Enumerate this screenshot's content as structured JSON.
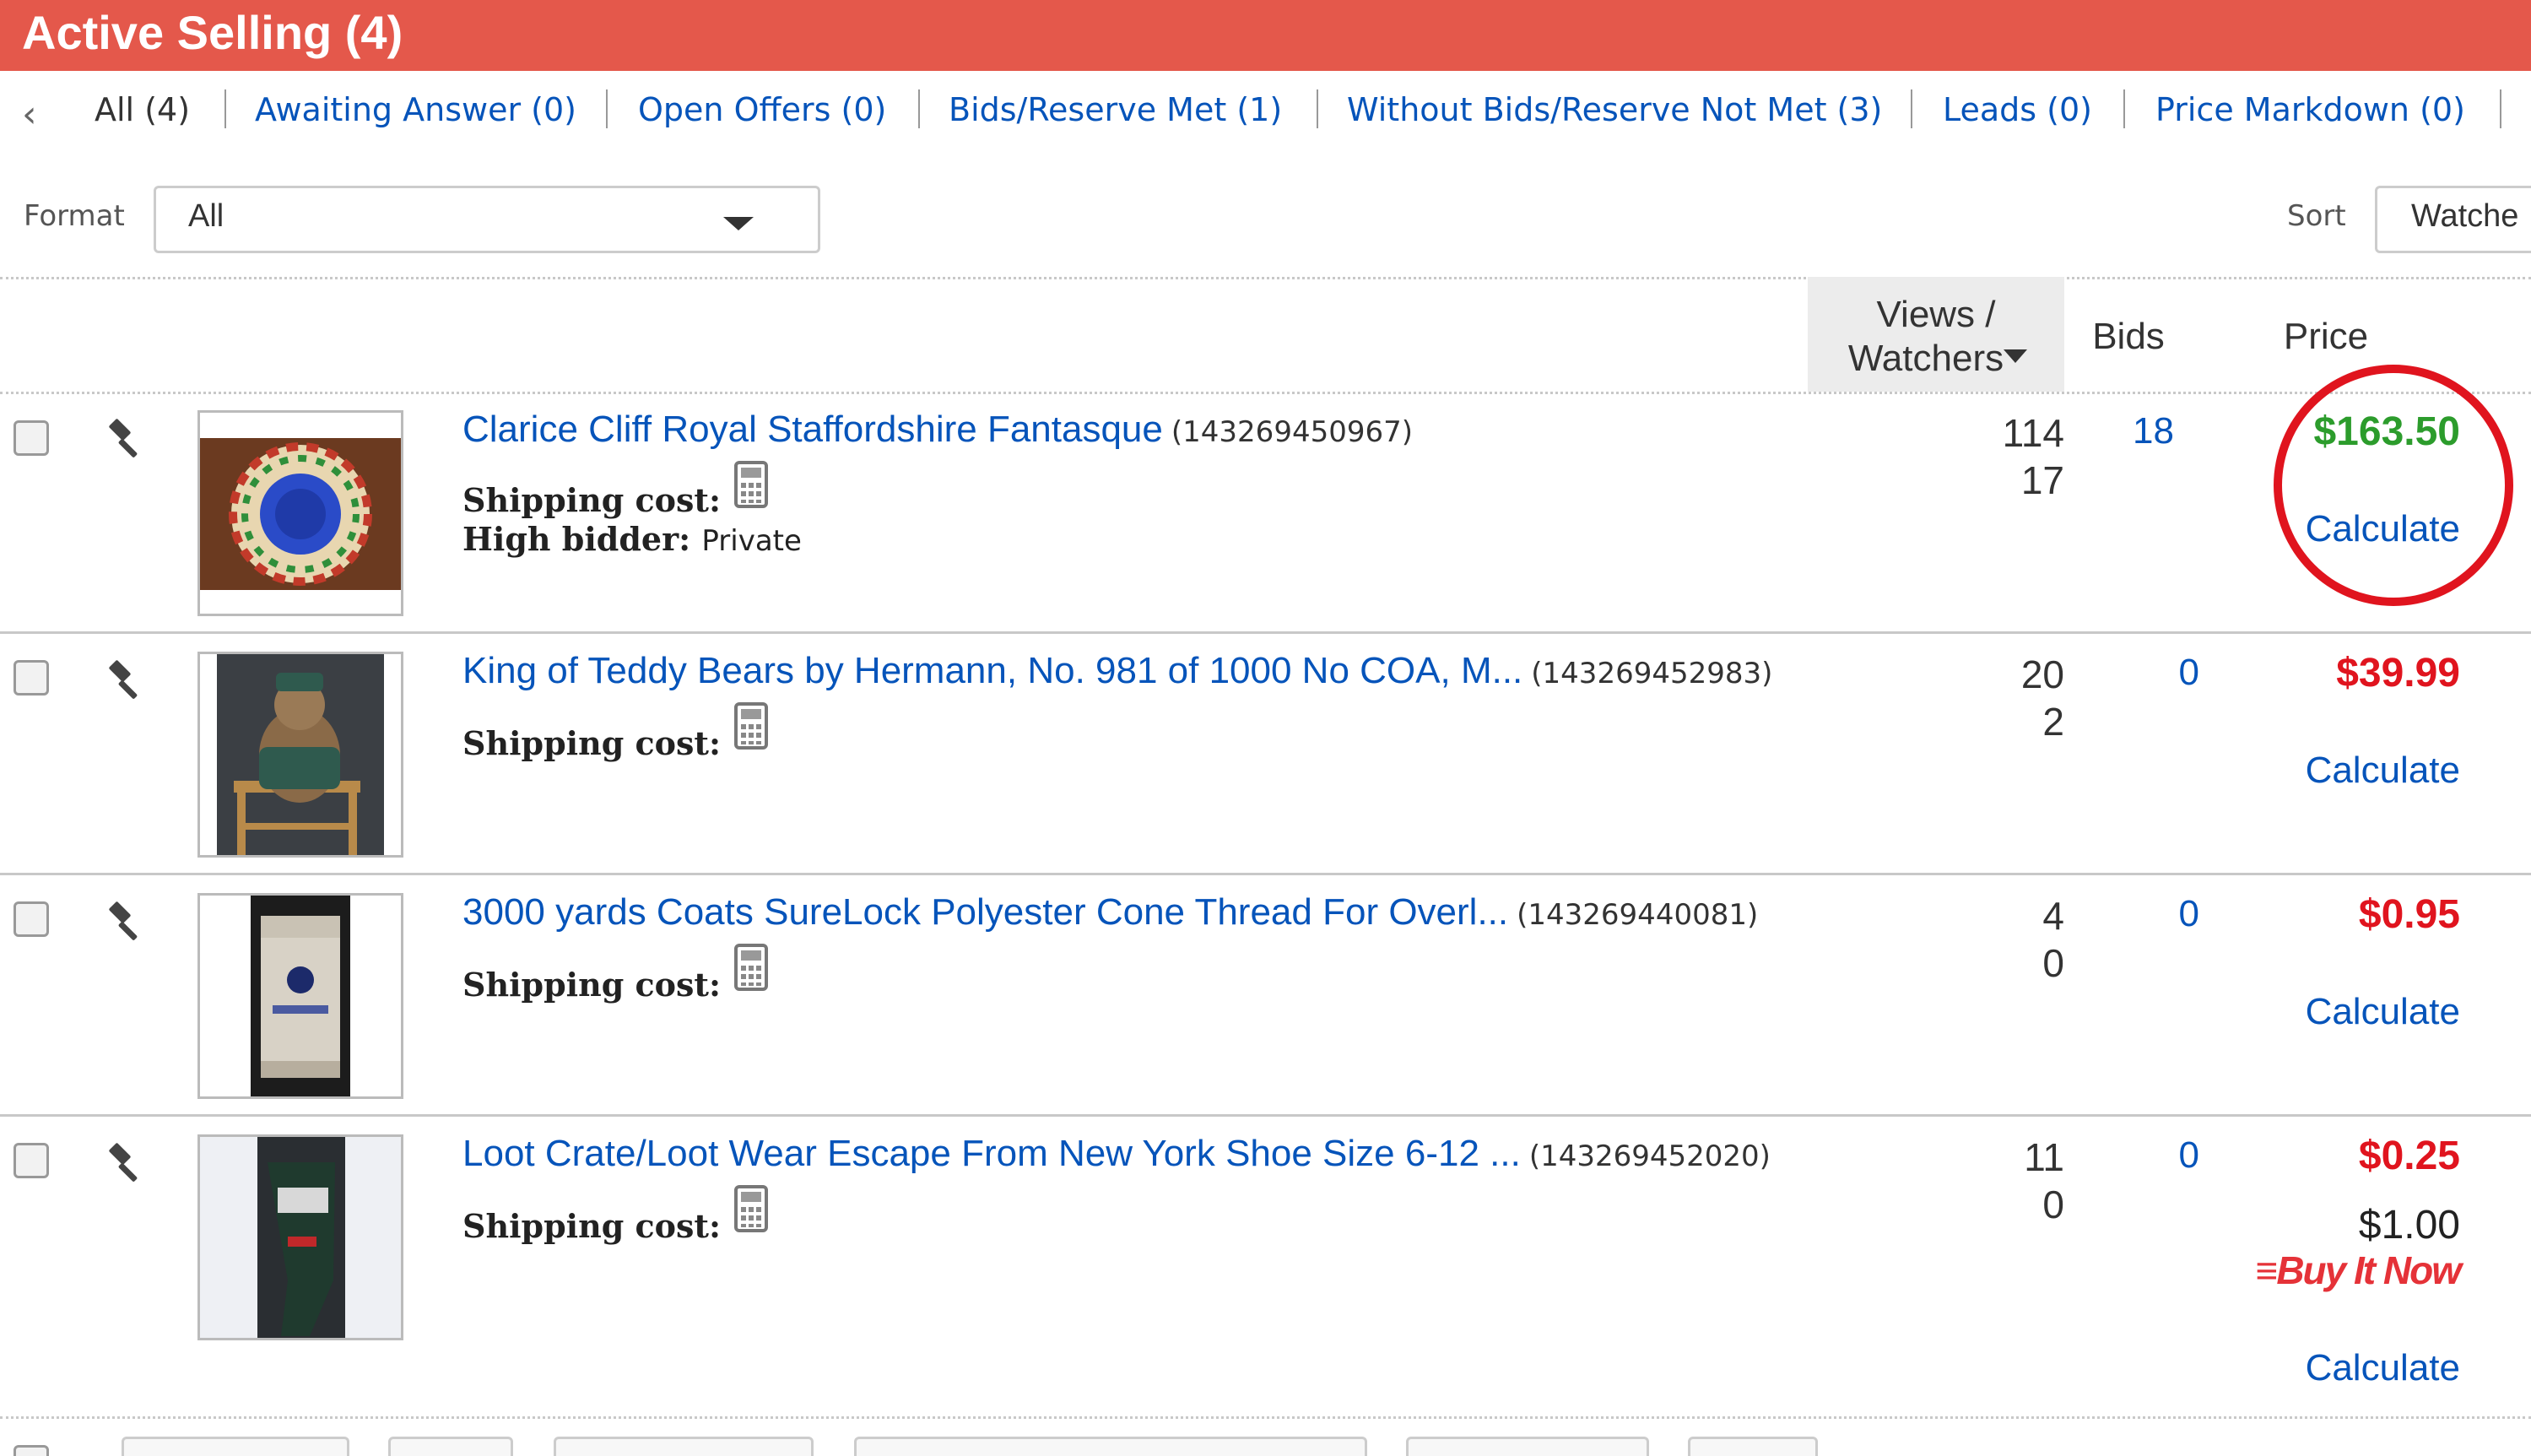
{
  "header": {
    "title": "Active Selling (4)"
  },
  "tabs": [
    {
      "label": "All (4)"
    },
    {
      "label": "Awaiting Answer (0)"
    },
    {
      "label": "Open Offers (0)"
    },
    {
      "label": "Bids/Reserve Met (1)"
    },
    {
      "label": "Without Bids/Reserve Not Met (3)"
    },
    {
      "label": "Leads (0)"
    },
    {
      "label": "Price Markdown (0)"
    }
  ],
  "filters": {
    "format_label": "Format",
    "format_value": "All",
    "sort_label": "Sort",
    "sort_value": "Watche"
  },
  "columns": {
    "views_line1": "Views /",
    "views_line2": "Watchers",
    "bids": "Bids",
    "price": "Price"
  },
  "labels": {
    "shipping": "Shipping cost:",
    "high_bidder": "High bidder:",
    "calculate": "Calculate"
  },
  "items": [
    {
      "title": "Clarice Cliff Royal Staffordshire Fantasque",
      "id": "(143269450967)",
      "views": "114",
      "watchers": "17",
      "bids": "18",
      "price": "$163.50",
      "price_color": "#2c9c2c",
      "high_bidder": "Private"
    },
    {
      "title": "King of Teddy Bears by Hermann, No. 981 of 1000 No COA, M...",
      "id": "(143269452983)",
      "views": "20",
      "watchers": "2",
      "bids": "0",
      "price": "$39.99",
      "price_color": "#e0141e"
    },
    {
      "title": "3000 yards Coats SureLock Polyester Cone Thread For Overl...",
      "id": "(143269440081)",
      "views": "4",
      "watchers": "0",
      "bids": "0",
      "price": "$0.95",
      "price_color": "#e0141e"
    },
    {
      "title": "Loot Crate/Loot Wear Escape From New York Shoe Size 6-12 ...",
      "id": "(143269452020)",
      "views": "11",
      "watchers": "0",
      "bids": "0",
      "price": "$0.25",
      "price_color": "#e0141e",
      "buy_it_now_price": "$1.00",
      "buy_it_now_label": "≡Buy It Now"
    }
  ],
  "icons": {
    "back": "chevron-left-icon",
    "dropdown": "chevron-down-icon",
    "auction": "gavel-icon",
    "shipping_calc": "calculator-icon"
  },
  "colors": {
    "header_bg": "#e4584b",
    "link": "#0654ba",
    "price_green": "#2c9c2c",
    "price_red": "#e0141e",
    "highlight_circle": "#e0141e"
  }
}
